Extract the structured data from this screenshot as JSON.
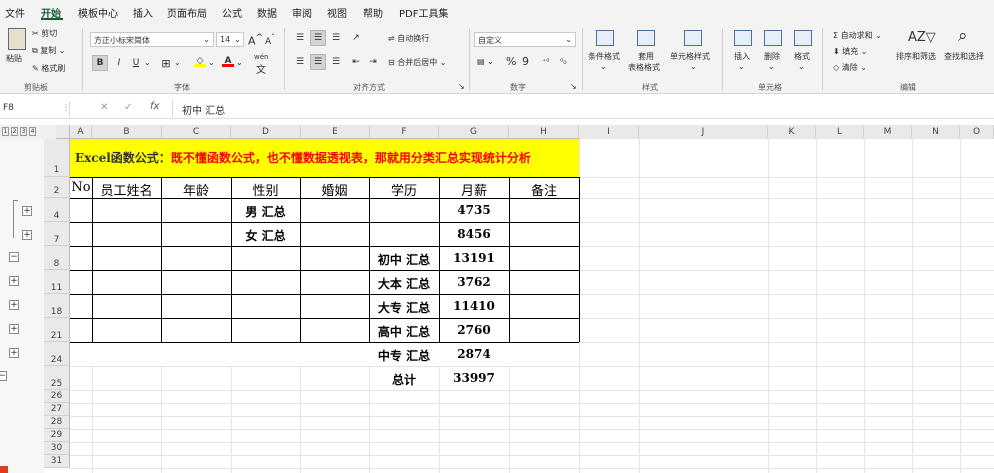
{
  "menu": {
    "items": [
      "文件",
      "开始",
      "模板中心",
      "插入",
      "页面布局",
      "公式",
      "数据",
      "审阅",
      "视图",
      "帮助",
      "PDF工具集"
    ],
    "active_index": 1
  },
  "ribbon": {
    "clipboard": {
      "paste": "粘贴",
      "cut": "剪切",
      "copy": "复制",
      "format_painter": "格式刷",
      "label": "剪贴板"
    },
    "font": {
      "name": "方正小标宋简体",
      "size": "14",
      "grow": "A",
      "shrink": "A",
      "bold": "B",
      "italic": "I",
      "underline": "U",
      "label": "字体",
      "wen": "wén"
    },
    "alignment": {
      "wrap": "自动换行",
      "merge": "合并后居中",
      "label": "对齐方式"
    },
    "number": {
      "format": "自定义",
      "percent": "%",
      "comma": "9",
      "label": "数字"
    },
    "styles": {
      "conditional": "条件格式",
      "table_line1": "套用",
      "table_line2": "表格格式",
      "cell_styles": "单元格样式",
      "label": "样式"
    },
    "cells": {
      "insert": "插入",
      "delete": "删除",
      "format": "格式",
      "label": "单元格"
    },
    "editing": {
      "autosum": "自动求和",
      "fill": "填充",
      "clear": "清除",
      "sort": "排序和筛选",
      "find": "查找和选择",
      "label": "编辑"
    }
  },
  "formula_bar": {
    "name_box": "F8",
    "cancel": "✕",
    "confirm": "✓",
    "fx": "fx",
    "content": "初中 汇总"
  },
  "outline_levels": [
    "1",
    "2",
    "3",
    "4"
  ],
  "columns": [
    "A",
    "B",
    "C",
    "D",
    "E",
    "F",
    "G",
    "H",
    "I",
    "J",
    "K",
    "L",
    "M",
    "N",
    "O"
  ],
  "rows": [
    "1",
    "2",
    "4",
    "7",
    "8",
    "11",
    "18",
    "21",
    "24",
    "25",
    "26",
    "27",
    "28",
    "29",
    "30",
    "31"
  ],
  "sheet": {
    "banner": {
      "prefix": "Excel函数公式：",
      "title": "既不懂函数公式，也不懂数据透视表，那就用分类汇总实现统计分析"
    },
    "headers": [
      "No",
      "员工姓名",
      "年龄",
      "性别",
      "婚姻",
      "学历",
      "月薪",
      "备注"
    ],
    "gender_rows": [
      {
        "label": "男 汇总",
        "value": "4735"
      },
      {
        "label": "女 汇总",
        "value": "8456"
      }
    ],
    "edu_rows": [
      {
        "label": "初中 汇总",
        "value": "13191"
      },
      {
        "label": "大本 汇总",
        "value": "3762"
      },
      {
        "label": "大专 汇总",
        "value": "11410"
      },
      {
        "label": "高中 汇总",
        "value": "2760"
      },
      {
        "label": "中专 汇总",
        "value": "2874"
      }
    ],
    "total": {
      "label": "总计",
      "value": "33997"
    }
  },
  "colors": {
    "banner_bg": "#ffff00",
    "banner_red": "#ff0000",
    "accent": "#185c37"
  }
}
